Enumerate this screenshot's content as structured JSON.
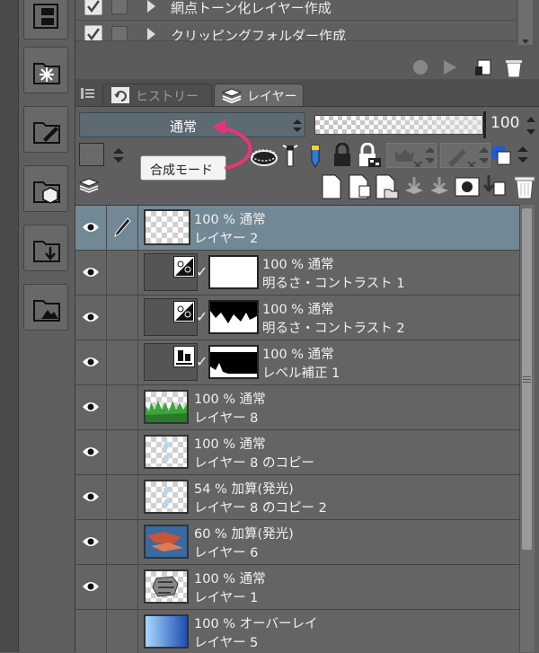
{
  "auto_actions": [
    {
      "label": "網点トーン化レイヤー作成"
    },
    {
      "label": "クリッピングフォルダー作成"
    }
  ],
  "tabs": {
    "history": "ヒストリー",
    "layer": "レイヤー"
  },
  "blend": {
    "mode": "通常",
    "tooltip": "合成モード"
  },
  "opacity": {
    "value": "100"
  },
  "layers": [
    {
      "opacity_mode": "100 % 通常",
      "name": "レイヤー 2",
      "selected": true,
      "kind": "raster"
    },
    {
      "opacity_mode": "100 % 通常",
      "name": "明るさ・コントラスト 1",
      "kind": "adjust"
    },
    {
      "opacity_mode": "100 % 通常",
      "name": "明るさ・コントラスト 2",
      "kind": "adjust"
    },
    {
      "opacity_mode": "100 % 通常",
      "name": "レベル補正 1",
      "kind": "adjust"
    },
    {
      "opacity_mode": "100 % 通常",
      "name": "レイヤー 8",
      "kind": "raster"
    },
    {
      "opacity_mode": "100 % 通常",
      "name": "レイヤー 8 のコピー",
      "kind": "raster"
    },
    {
      "opacity_mode": "54 % 加算(発光)",
      "name": "レイヤー 8 のコピー 2",
      "kind": "raster"
    },
    {
      "opacity_mode": "60 % 加算(発光)",
      "name": "レイヤー 6",
      "kind": "raster"
    },
    {
      "opacity_mode": "100 % 通常",
      "name": "レイヤー 1",
      "kind": "raster"
    },
    {
      "opacity_mode": "100 % オーバーレイ",
      "name": "レイヤー 5",
      "kind": "raster"
    }
  ],
  "colors": {
    "selected_row": "#728895",
    "annotation_arrow": "#e8337a"
  }
}
